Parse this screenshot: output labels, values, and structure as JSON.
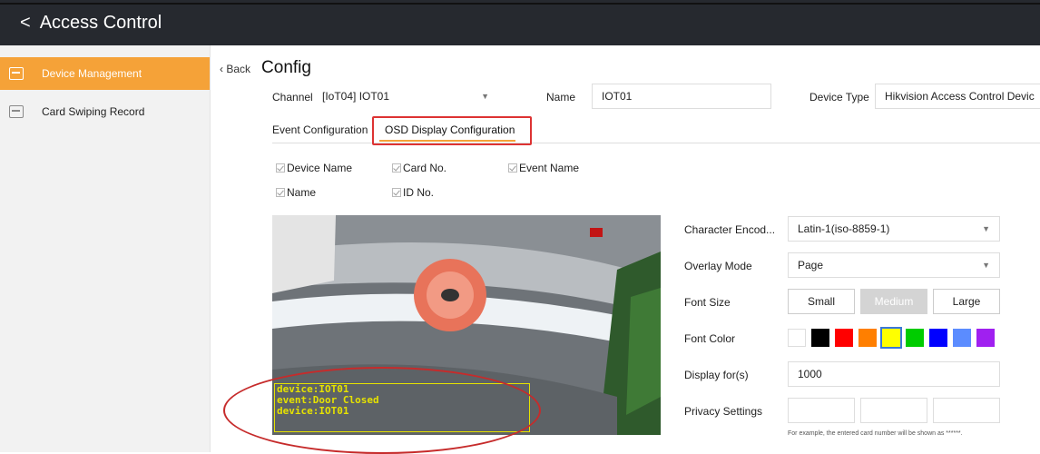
{
  "app": {
    "back_glyph": "<",
    "title": "Access Control"
  },
  "sidebar": {
    "items": [
      {
        "label": "Device Management",
        "icon": "device-management-icon",
        "active": true
      },
      {
        "label": "Card Swiping Record",
        "icon": "card-record-icon",
        "active": false
      }
    ]
  },
  "header": {
    "back_label": "Back",
    "title": "Config"
  },
  "form": {
    "channel_label": "Channel",
    "channel_value": "[IoT04] IOT01",
    "name_label": "Name",
    "name_value": "IOT01",
    "device_type_label": "Device Type",
    "device_type_value": "Hikvision Access Control Devic"
  },
  "tabs": [
    {
      "label": "Event Configuration",
      "active": false
    },
    {
      "label": "OSD Display Configuration",
      "active": true
    }
  ],
  "checkboxes": [
    {
      "label": "Device Name",
      "checked": true
    },
    {
      "label": "Card No.",
      "checked": true
    },
    {
      "label": "Event Name",
      "checked": true
    },
    {
      "label": "Name",
      "checked": true
    },
    {
      "label": "ID No.",
      "checked": true
    }
  ],
  "osd_overlay": {
    "line1": "device:IOT01",
    "line2": "event:Door Closed",
    "line3": "device:IOT01"
  },
  "settings": {
    "char_encoding_label": "Character Encod...",
    "char_encoding_value": "Latin-1(iso-8859-1)",
    "overlay_mode_label": "Overlay Mode",
    "overlay_mode_value": "Page",
    "font_size_label": "Font Size",
    "font_size_options": [
      "Small",
      "Medium",
      "Large"
    ],
    "font_size_selected": "Medium",
    "font_color_label": "Font Color",
    "font_colors": [
      "#ffffff",
      "#000000",
      "#ff0000",
      "#ff7f00",
      "#ffff00",
      "#00cc00",
      "#0000ff",
      "#5b8cff",
      "#a020f0"
    ],
    "font_color_selected": "#ffff00",
    "display_for_label": "Display for(s)",
    "display_for_value": "1000",
    "privacy_label": "Privacy Settings",
    "privacy_hint": "For example, the entered card number will be shown as ******."
  },
  "colors": {
    "topbar": "#26292f",
    "accent": "#f5a238",
    "highlight": "#d33333"
  }
}
